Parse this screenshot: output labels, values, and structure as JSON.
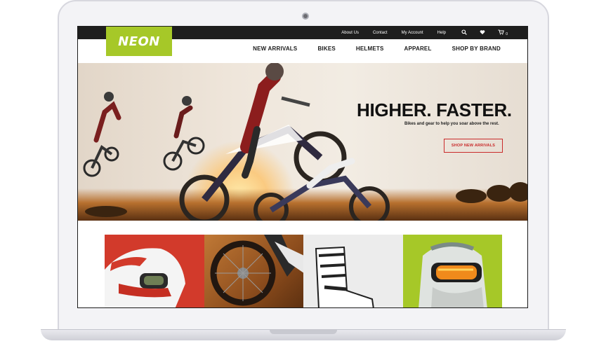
{
  "brand": {
    "logo_text": "NEON",
    "accent_color": "#a6c828",
    "cta_color": "#c92a2a"
  },
  "topbar": {
    "links": [
      "About Us",
      "Contact",
      "My Account",
      "Help"
    ],
    "cart_count": "0"
  },
  "nav": {
    "items": [
      "NEW ARRIVALS",
      "BIKES",
      "HELMETS",
      "APPAREL",
      "SHOP BY BRAND"
    ]
  },
  "hero": {
    "title": "HIGHER. FASTER.",
    "subtitle": "Bikes and gear to help you soar above the rest.",
    "cta_label": "SHOP NEW ARRIVALS"
  },
  "icons": {
    "search": "search-icon",
    "wishlist": "heart-icon",
    "cart": "cart-icon"
  },
  "tiles": [
    "helmet-image",
    "dirt-bike-wheel-image",
    "riding-boot-image",
    "goggles-helmet-image"
  ]
}
